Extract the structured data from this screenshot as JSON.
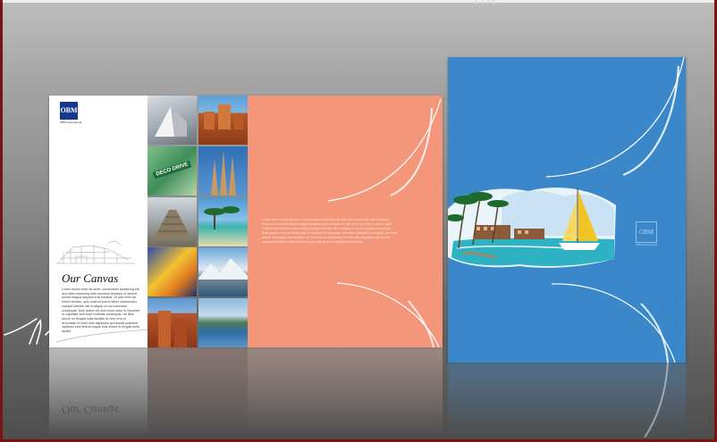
{
  "left_brochure": {
    "logo": "OBM",
    "logo_tagline": "OBM International",
    "title": "Our Canvas",
    "body_text": "Lorem ipsum dolor sit amet, consectetur adipiscing elit, sed diam nonummy nibh euismod tincidunt ut laoreet dolore magna aliquam erat volutpat. Ut wisi enim ad minim veniam, quis nostrud exerci tation ullamcorper suscipit lobortis nisl ut aliquip ex ea commodo consequat. Duis autem vel eum iriure dolor in hendrerit in vulputate velit esse molestie consequat, vel illum dolore eu feugiat nulla facilisis at vero eros et accumsan et iusto odio dignissim qui blandit praesent luptatum zzril delenit augue duis dolore te feugait nulla facilisi.",
    "photo_sign_text": "DECO DRIVE",
    "panel_body_text": "Lorem ipsum dolor sit amet, consectetur adipiscing elit, sed diam nonummy nibh euismod tincidunt ut laoreet dolore magna aliquam erat volutpat. Ut wisi enim ad minim veniam, quis nostrud exerci tation ullamcorper suscipit lobortis nisl ut aliquip ex ea commodo consequat. Duis autem vel eum iriure dolor in hendrerit in vulputate velit esse molestie consequat, vel illum dolore eu feugiat nulla facilisis at vero eros et accumsan et iusto odio dignissim qui blandit praesent luptatum zzril delenit augue duis dolore te feugait nulla facilisi."
  },
  "right_brochure": {
    "logo": "OBM",
    "logo_tagline": "OBM International"
  },
  "reflection": {
    "title": "Our Canvas"
  },
  "colors": {
    "frame": "#7a1414",
    "salmon_panel": "#f4967a",
    "blue_panel": "#3a88c9",
    "logo_blue": "#13398b"
  }
}
